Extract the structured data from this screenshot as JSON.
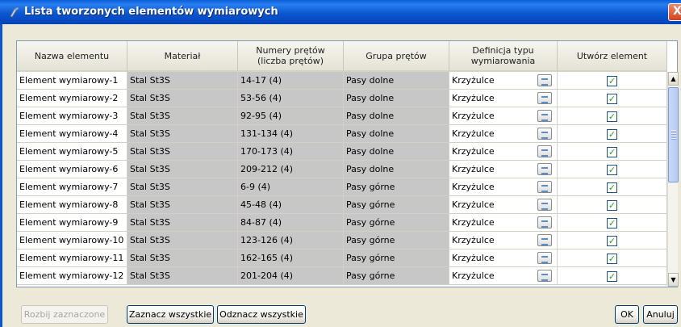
{
  "window": {
    "title": "Lista tworzonych elementów wymiarowych",
    "close_label": "X"
  },
  "table": {
    "headers": [
      "Nazwa elementu",
      "Materiał",
      "Numery prętów (liczba prętów)",
      "Grupa prętów",
      "Definicja typu wymiarowania",
      "Utwórz element"
    ],
    "rows": [
      {
        "name": "Element wymiarowy-1",
        "material": "Stal St3S",
        "bars": "14-17 (4)",
        "group": "Pasy dolne",
        "definition": "Krzyżulce",
        "create": true
      },
      {
        "name": "Element wymiarowy-2",
        "material": "Stal St3S",
        "bars": "53-56 (4)",
        "group": "Pasy dolne",
        "definition": "Krzyżulce",
        "create": true
      },
      {
        "name": "Element wymiarowy-3",
        "material": "Stal St3S",
        "bars": "92-95 (4)",
        "group": "Pasy dolne",
        "definition": "Krzyżulce",
        "create": true
      },
      {
        "name": "Element wymiarowy-4",
        "material": "Stal St3S",
        "bars": "131-134 (4)",
        "group": "Pasy dolne",
        "definition": "Krzyżulce",
        "create": true
      },
      {
        "name": "Element wymiarowy-5",
        "material": "Stal St3S",
        "bars": "170-173 (4)",
        "group": "Pasy dolne",
        "definition": "Krzyżulce",
        "create": true
      },
      {
        "name": "Element wymiarowy-6",
        "material": "Stal St3S",
        "bars": "209-212 (4)",
        "group": "Pasy dolne",
        "definition": "Krzyżulce",
        "create": true
      },
      {
        "name": "Element wymiarowy-7",
        "material": "Stal St3S",
        "bars": "6-9 (4)",
        "group": "Pasy górne",
        "definition": "Krzyżulce",
        "create": true
      },
      {
        "name": "Element wymiarowy-8",
        "material": "Stal St3S",
        "bars": "45-48 (4)",
        "group": "Pasy górne",
        "definition": "Krzyżulce",
        "create": true
      },
      {
        "name": "Element wymiarowy-9",
        "material": "Stal St3S",
        "bars": "84-87 (4)",
        "group": "Pasy górne",
        "definition": "Krzyżulce",
        "create": true
      },
      {
        "name": "Element wymiarowy-10",
        "material": "Stal St3S",
        "bars": "123-126 (4)",
        "group": "Pasy górne",
        "definition": "Krzyżulce",
        "create": true
      },
      {
        "name": "Element wymiarowy-11",
        "material": "Stal St3S",
        "bars": "162-165 (4)",
        "group": "Pasy górne",
        "definition": "Krzyżulce",
        "create": true
      },
      {
        "name": "Element wymiarowy-12",
        "material": "Stal St3S",
        "bars": "201-204 (4)",
        "group": "Pasy górne",
        "definition": "Krzyżulce",
        "create": true
      }
    ]
  },
  "buttons": {
    "split": "Rozbij zaznaczone",
    "select_all": "Zaznacz wszystkie",
    "deselect_all": "Odznacz wszystkie",
    "ok": "OK",
    "cancel": "Anuluj"
  },
  "colors": {
    "titlebar": "#0b57d0",
    "readonly_cell": "#c7c7c7",
    "checkmark": "#21a121",
    "dialog_bg": "#ece9d8"
  }
}
